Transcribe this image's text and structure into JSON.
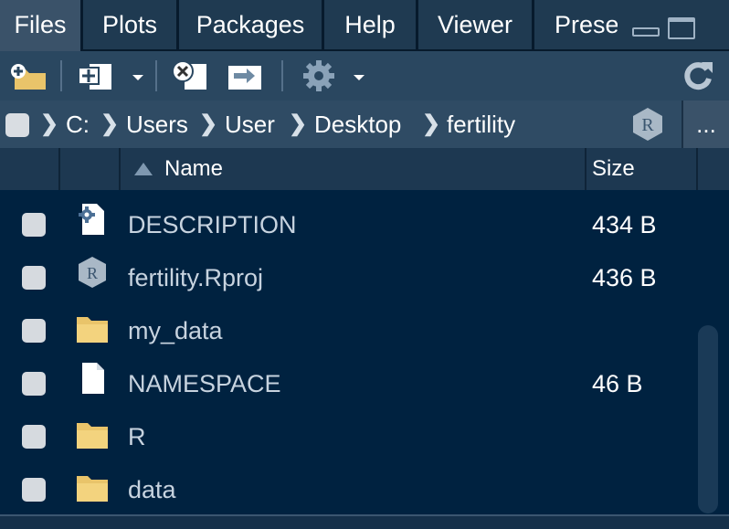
{
  "tabs": [
    {
      "label": "Files",
      "active": true
    },
    {
      "label": "Plots",
      "active": false
    },
    {
      "label": "Packages",
      "active": false
    },
    {
      "label": "Help",
      "active": false
    },
    {
      "label": "Viewer",
      "active": false
    },
    {
      "label": "Prese",
      "active": false
    }
  ],
  "toolbar": {
    "icons": [
      "new-folder-icon",
      "new-file-icon",
      "delete-icon",
      "rename-icon",
      "gear-icon",
      "refresh-icon"
    ]
  },
  "path": {
    "segments": [
      "C:",
      "Users",
      "User",
      "Desktop",
      "fertility"
    ],
    "more_label": "..."
  },
  "table": {
    "columns": [
      "Name",
      "Size"
    ],
    "sort": "ascending",
    "rows": [
      {
        "name": "DESCRIPTION",
        "size": "434 B",
        "icon": "description-icon"
      },
      {
        "name": "fertility.Rproj",
        "size": "436 B",
        "icon": "rproj-icon"
      },
      {
        "name": "my_data",
        "size": "",
        "icon": "folder-icon"
      },
      {
        "name": "NAMESPACE",
        "size": "46 B",
        "icon": "file-icon"
      },
      {
        "name": "R",
        "size": "",
        "icon": "folder-icon"
      },
      {
        "name": "data",
        "size": "",
        "icon": "folder-icon"
      }
    ]
  },
  "colors": {
    "background": "#002240",
    "tab_bg": "#1f3a51",
    "tab_active": "#3a5269",
    "folder": "#e9c46a"
  }
}
